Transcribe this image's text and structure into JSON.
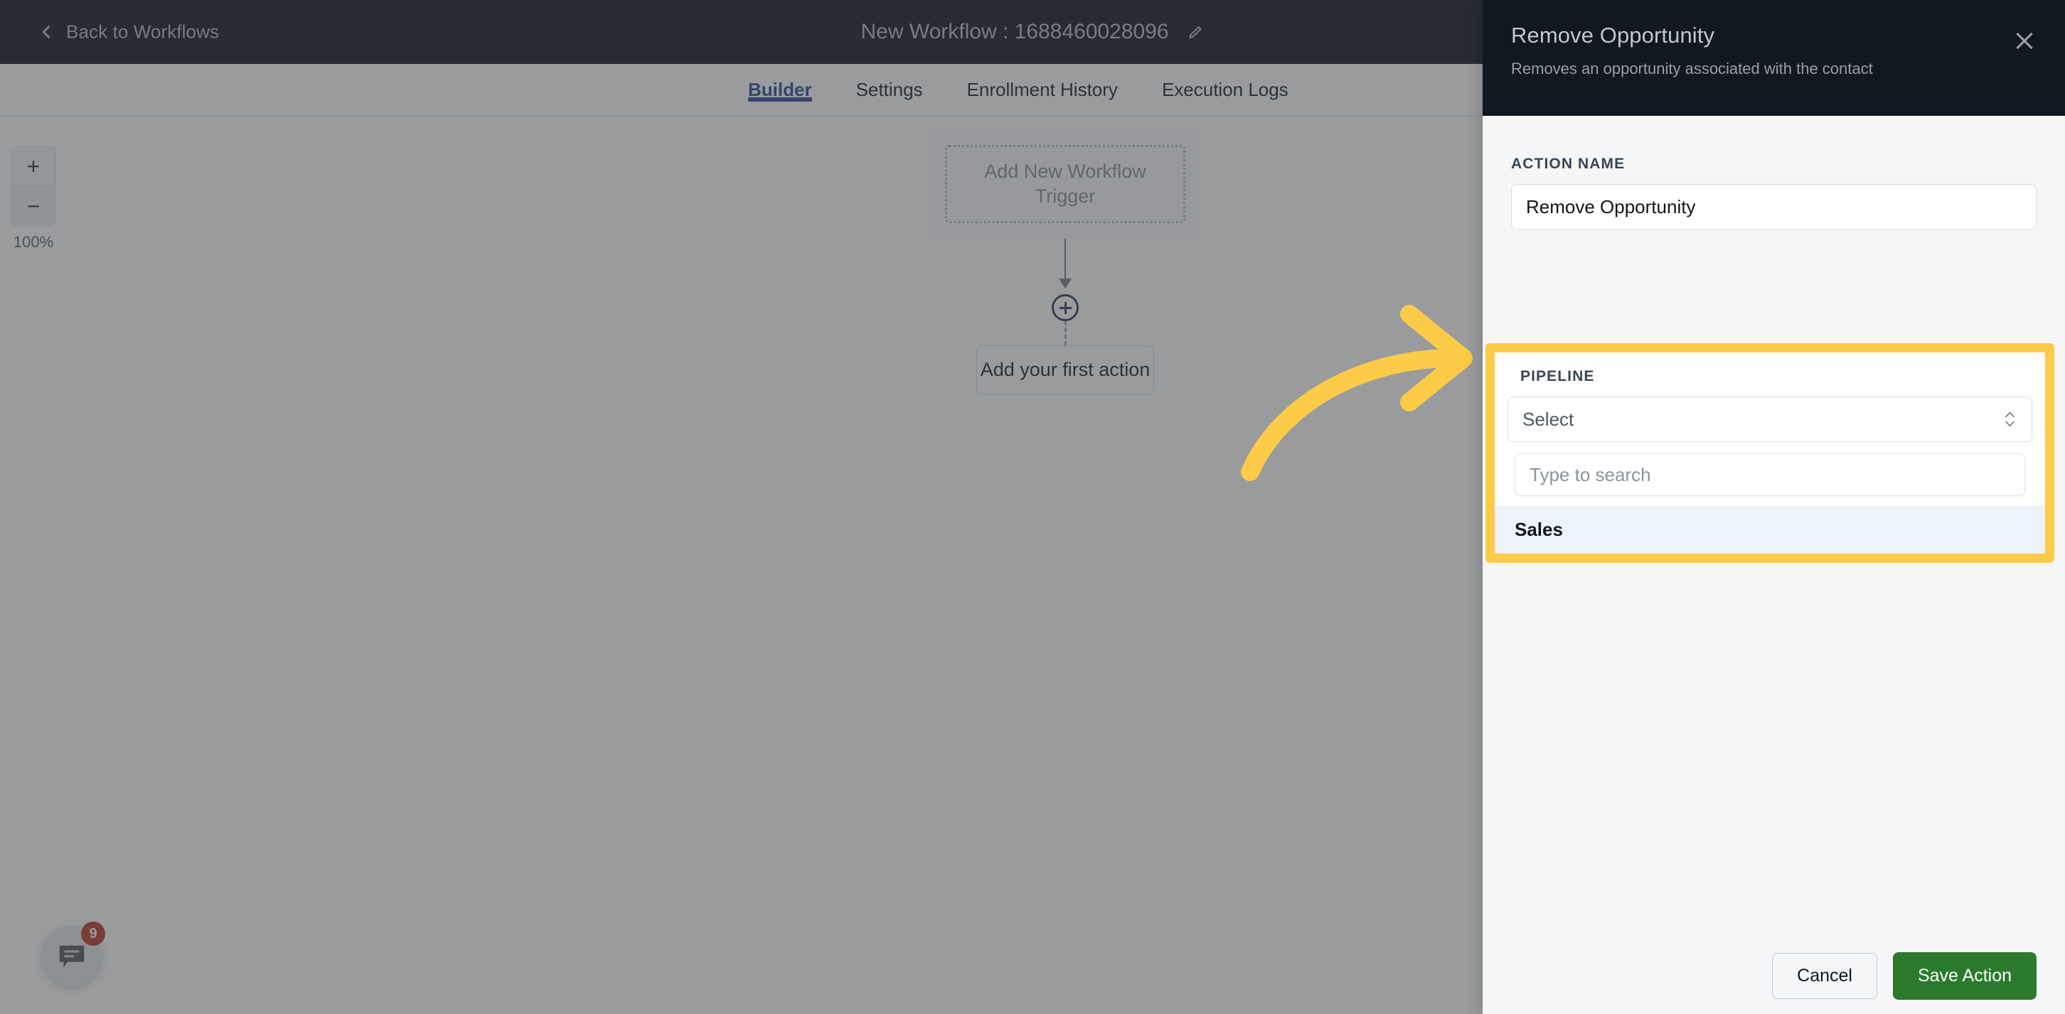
{
  "topbar": {
    "back_label": "Back to Workflows",
    "workflow_title": "New Workflow : 1688460028096",
    "edit_icon": "pencil-icon",
    "back_icon": "chevron-left-icon"
  },
  "tabs": [
    {
      "label": "Builder",
      "active": true
    },
    {
      "label": "Settings",
      "active": false
    },
    {
      "label": "Enrollment History",
      "active": false
    },
    {
      "label": "Execution Logs",
      "active": false
    }
  ],
  "canvas": {
    "zoom": {
      "zoom_in_label": "+",
      "zoom_out_label": "−",
      "level": "100%"
    },
    "trigger_text": "Add New Workflow Trigger",
    "add_node_icon": "plus-circle-icon",
    "first_action_label": "Add your first action",
    "chat_widget": {
      "icon": "chat-bubble-icon",
      "badge": "9"
    }
  },
  "panel": {
    "title": "Remove Opportunity",
    "subtitle": "Removes an opportunity associated with the contact",
    "close_icon": "close-icon",
    "action_name": {
      "label": "ACTION NAME",
      "value": "Remove Opportunity"
    },
    "pipeline": {
      "label": "PIPELINE",
      "select_value": "Select",
      "caret_icon": "chevron-up-down-icon",
      "search_placeholder": "Type to search",
      "options": [
        {
          "label": "Sales",
          "highlighted": true
        }
      ]
    },
    "footer": {
      "cancel_label": "Cancel",
      "save_label": "Save Action"
    }
  },
  "annotation": {
    "arrow_icon": "curved-arrow-right-icon",
    "highlight_color": "#FCCB47"
  }
}
